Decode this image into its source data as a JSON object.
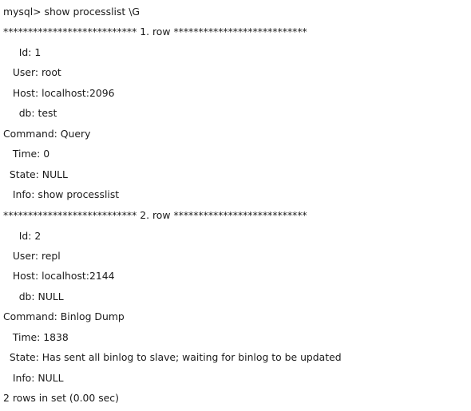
{
  "terminal": {
    "command": "mysql> show processlist \\G",
    "rows": [
      {
        "separator": "*************************** 1. row ***************************",
        "fields": [
          {
            "label": "     Id: ",
            "value": "1"
          },
          {
            "label": "   User: ",
            "value": "root"
          },
          {
            "label": "   Host: ",
            "value": "localhost:2096"
          },
          {
            "label": "     db: ",
            "value": "test"
          },
          {
            "label": "Command: ",
            "value": "Query"
          },
          {
            "label": "   Time: ",
            "value": "0"
          },
          {
            "label": "  State: ",
            "value": "NULL"
          },
          {
            "label": "   Info: ",
            "value": "show processlist"
          }
        ]
      },
      {
        "separator": "*************************** 2. row ***************************",
        "fields": [
          {
            "label": "     Id: ",
            "value": "2"
          },
          {
            "label": "   User: ",
            "value": "repl"
          },
          {
            "label": "   Host: ",
            "value": "localhost:2144"
          },
          {
            "label": "     db: ",
            "value": "NULL"
          },
          {
            "label": "Command: ",
            "value": "Binlog Dump"
          },
          {
            "label": "   Time: ",
            "value": "1838"
          },
          {
            "label": "  State: ",
            "value": "Has sent all binlog to slave; waiting for binlog to be updated"
          },
          {
            "label": "   Info: ",
            "value": "NULL"
          }
        ]
      }
    ],
    "summary": "2 rows in set (0.00 sec)"
  }
}
